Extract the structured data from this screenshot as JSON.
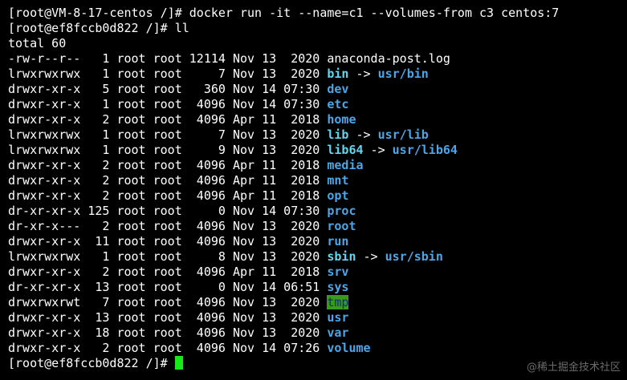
{
  "terminal": {
    "lines": [
      [
        {
          "t": "[root@VM-8-17-centos /]# docker run -it --name=c1 --volumes-from c3 centos:7",
          "k": "text"
        }
      ],
      [
        {
          "t": "[root@ef8fccb0d822 /]# ll",
          "k": "text"
        }
      ],
      [
        {
          "t": "total 60",
          "k": "text"
        }
      ],
      [
        {
          "t": "-rw-r--r--   1 root root 12114 Nov 13  2020 anaconda-post.log",
          "k": "text"
        }
      ],
      [
        {
          "t": "lrwxrwxrwx   1 root root     7 Nov 13  2020 ",
          "k": "text"
        },
        {
          "t": "bin",
          "k": "link"
        },
        {
          "t": " -> ",
          "k": "arrow"
        },
        {
          "t": "usr/bin",
          "k": "dir"
        }
      ],
      [
        {
          "t": "drwxr-xr-x   5 root root   360 Nov 14 07:30 ",
          "k": "text"
        },
        {
          "t": "dev",
          "k": "dir"
        }
      ],
      [
        {
          "t": "drwxr-xr-x   1 root root  4096 Nov 14 07:30 ",
          "k": "text"
        },
        {
          "t": "etc",
          "k": "dir"
        }
      ],
      [
        {
          "t": "drwxr-xr-x   2 root root  4096 Apr 11  2018 ",
          "k": "text"
        },
        {
          "t": "home",
          "k": "dir"
        }
      ],
      [
        {
          "t": "lrwxrwxrwx   1 root root     7 Nov 13  2020 ",
          "k": "text"
        },
        {
          "t": "lib",
          "k": "link"
        },
        {
          "t": " -> ",
          "k": "arrow"
        },
        {
          "t": "usr/lib",
          "k": "dir"
        }
      ],
      [
        {
          "t": "lrwxrwxrwx   1 root root     9 Nov 13  2020 ",
          "k": "text"
        },
        {
          "t": "lib64",
          "k": "link"
        },
        {
          "t": " -> ",
          "k": "arrow"
        },
        {
          "t": "usr/lib64",
          "k": "dir"
        }
      ],
      [
        {
          "t": "drwxr-xr-x   2 root root  4096 Apr 11  2018 ",
          "k": "text"
        },
        {
          "t": "media",
          "k": "dir"
        }
      ],
      [
        {
          "t": "drwxr-xr-x   2 root root  4096 Apr 11  2018 ",
          "k": "text"
        },
        {
          "t": "mnt",
          "k": "dir"
        }
      ],
      [
        {
          "t": "drwxr-xr-x   2 root root  4096 Apr 11  2018 ",
          "k": "text"
        },
        {
          "t": "opt",
          "k": "dir"
        }
      ],
      [
        {
          "t": "dr-xr-xr-x 125 root root     0 Nov 14 07:30 ",
          "k": "text"
        },
        {
          "t": "proc",
          "k": "dir"
        }
      ],
      [
        {
          "t": "dr-xr-x---   2 root root  4096 Nov 13  2020 ",
          "k": "text"
        },
        {
          "t": "root",
          "k": "dir"
        }
      ],
      [
        {
          "t": "drwxr-xr-x  11 root root  4096 Nov 13  2020 ",
          "k": "text"
        },
        {
          "t": "run",
          "k": "dir"
        }
      ],
      [
        {
          "t": "lrwxrwxrwx   1 root root     8 Nov 13  2020 ",
          "k": "text"
        },
        {
          "t": "sbin",
          "k": "link"
        },
        {
          "t": " -> ",
          "k": "arrow"
        },
        {
          "t": "usr/sbin",
          "k": "dir"
        }
      ],
      [
        {
          "t": "drwxr-xr-x   2 root root  4096 Apr 11  2018 ",
          "k": "text"
        },
        {
          "t": "srv",
          "k": "dir"
        }
      ],
      [
        {
          "t": "dr-xr-xr-x  13 root root     0 Nov 14 06:51 ",
          "k": "text"
        },
        {
          "t": "sys",
          "k": "dir"
        }
      ],
      [
        {
          "t": "drwxrwxrwt   7 root root  4096 Nov 13  2020 ",
          "k": "text"
        },
        {
          "t": "tmp",
          "k": "sticky"
        }
      ],
      [
        {
          "t": "drwxr-xr-x  13 root root  4096 Nov 13  2020 ",
          "k": "text"
        },
        {
          "t": "usr",
          "k": "dir"
        }
      ],
      [
        {
          "t": "drwxr-xr-x  18 root root  4096 Nov 13  2020 ",
          "k": "text"
        },
        {
          "t": "var",
          "k": "dir"
        }
      ],
      [
        {
          "t": "drwxr-xr-x   2 root root  4096 Nov 14 07:26 ",
          "k": "text"
        },
        {
          "t": "volume",
          "k": "dir"
        }
      ]
    ],
    "prompt": "[root@ef8fccb0d822 /]# ",
    "colors": {
      "background": "#000000",
      "text": "#ffffff",
      "directory": "#4aa6e8",
      "symlink": "#5fd7f0",
      "sticky_bg": "#3a9a1a",
      "sticky_fg": "#0b2a8a",
      "cursor": "#17e817"
    }
  },
  "watermark": {
    "text": "@稀土掘金技术社区"
  }
}
